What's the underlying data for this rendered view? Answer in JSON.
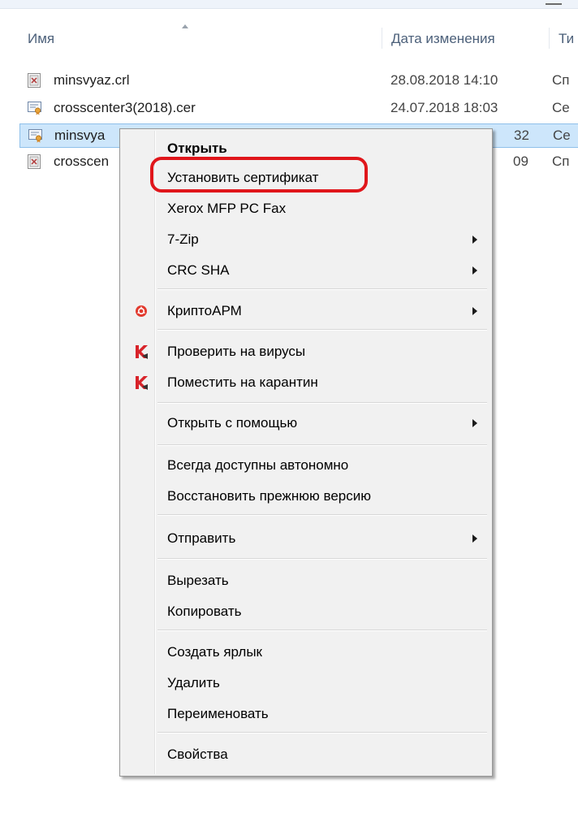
{
  "columns": {
    "name": "Имя",
    "date": "Дата изменения",
    "type": "Ти"
  },
  "files": [
    {
      "name": "minsvyaz.crl",
      "date": "28.08.2018 14:10",
      "type": "Сп",
      "icon": "crl-file-icon"
    },
    {
      "name": "crosscenter3(2018).cer",
      "date": "24.07.2018 18:03",
      "type": "Се",
      "icon": "certificate-file-icon"
    },
    {
      "name": "minsvya",
      "date": "32",
      "type": "Се",
      "icon": "certificate-file-icon",
      "selected": true
    },
    {
      "name": "crosscen",
      "date": "09",
      "type": "Сп",
      "icon": "crl-file-icon"
    }
  ],
  "menu": {
    "open": "Открыть",
    "install_cert": "Установить сертификат",
    "xerox": "Xerox MFP PC Fax",
    "zip": "7-Zip",
    "crc": "CRC SHA",
    "cryptoarm": "КриптоАРМ",
    "scan_virus": "Проверить на вирусы",
    "quarantine": "Поместить на карантин",
    "open_with": "Открыть с помощью",
    "offline": "Всегда доступны автономно",
    "restore": "Восстановить прежнюю версию",
    "send_to": "Отправить",
    "cut": "Вырезать",
    "copy": "Копировать",
    "shortcut": "Создать ярлык",
    "delete": "Удалить",
    "rename": "Переименовать",
    "properties": "Свойства"
  },
  "colors": {
    "highlight_ring": "#e0161b",
    "selection": "#cde6fb",
    "kaspersky": "#d8232a"
  }
}
